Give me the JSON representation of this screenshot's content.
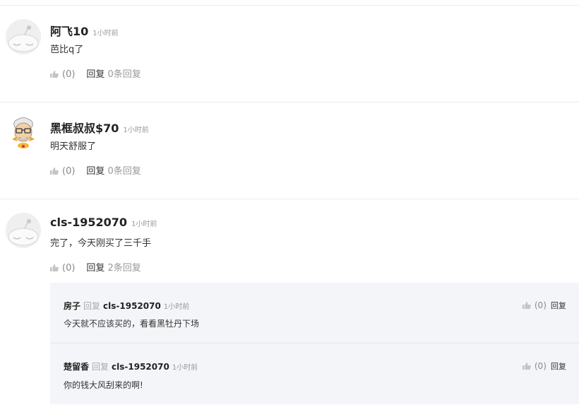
{
  "comments": [
    {
      "username": "阿飞10",
      "time": "1小时前",
      "text": "芭比q了",
      "likes": "(0)",
      "reply_label": "回复",
      "reply_count": "0条回复"
    },
    {
      "username": "黑框叔叔$70",
      "time": "1小时前",
      "text": "明天舒服了",
      "likes": "(0)",
      "reply_label": "回复",
      "reply_count": "0条回复"
    },
    {
      "username": "cls-1952070",
      "time": "1小时前",
      "text": "完了，今天刚买了三千手",
      "likes": "(0)",
      "reply_label": "回复",
      "reply_count": "2条回复"
    }
  ],
  "replies": [
    {
      "username": "房子",
      "reply_word": "回复",
      "target": "cls-1952070",
      "time": "1小时前",
      "text": "今天就不应该买的，看看黑牡丹下场",
      "likes": "(0)",
      "reply_label": "回复"
    },
    {
      "username": "楚留香",
      "reply_word": "回复",
      "target": "cls-1952070",
      "time": "1小时前",
      "text": "你的钱大风刮来的啊!",
      "likes": "(0)",
      "reply_label": "回复"
    }
  ],
  "colors": {
    "divider": "#ececec",
    "reply_bg": "#f4f5f8",
    "muted": "#999999"
  },
  "icons": [
    "default-avatar-icon",
    "old-man-avatar-icon",
    "thumbs-up-icon"
  ]
}
